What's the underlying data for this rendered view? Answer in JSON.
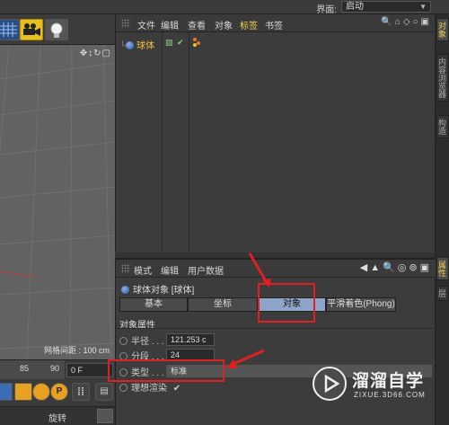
{
  "topbar": {
    "layout_label": "界面:",
    "layout_value": "启动"
  },
  "viewport": {
    "nav_icons": "✥↕↻▢",
    "grid_spacing": "网格间距 : 100 cm"
  },
  "timeline": {
    "tick_85": "85",
    "tick_90": "90",
    "frame": "0 F"
  },
  "bottom": {
    "rotate_label": "旋转"
  },
  "object_manager": {
    "menu": [
      "文件",
      "编辑",
      "查看",
      "对象",
      "标签",
      "书签"
    ],
    "active_menu": "标签",
    "object_name": "球体",
    "row_flags": "▨ ✔"
  },
  "right_tabs": [
    "对象",
    "内容浏览器",
    "构造"
  ],
  "right_tabs_lower": [
    "属性",
    "层"
  ],
  "attribute_manager": {
    "menu": [
      "模式",
      "编辑",
      "用户数据"
    ],
    "title": "球体对象 [球体]",
    "tabs": [
      "基本",
      "坐标",
      "对象",
      "平滑着色(Phong)"
    ],
    "selected_tab": "对象",
    "group_title": "对象属性",
    "params": [
      {
        "label": "半径 . . .",
        "value": "121.253 c"
      },
      {
        "label": "分段 . . .",
        "value": "24"
      },
      {
        "label": "类型 . . .",
        "value": "标准"
      },
      {
        "label": "理想渲染",
        "value": "✔"
      }
    ]
  },
  "watermark": {
    "name": "溜溜自学",
    "url": "ZIXUE.3D66.COM"
  },
  "colors": {
    "highlight_red": "#e02020",
    "active_tag": "#f0d050",
    "selected_tab": "#8ea4c8"
  }
}
